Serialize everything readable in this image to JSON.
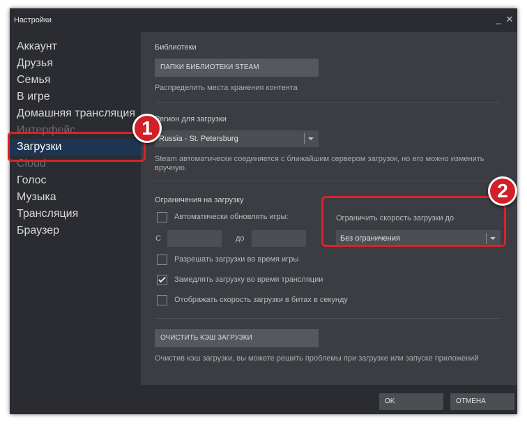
{
  "window": {
    "title": "Настройки"
  },
  "controls": {
    "minimize_icon": "minimize-icon",
    "close_icon": "close-icon",
    "minimize": "_",
    "close": "✕"
  },
  "sidebar": {
    "items": [
      {
        "label": "Аккаунт"
      },
      {
        "label": "Друзья"
      },
      {
        "label": "Семья"
      },
      {
        "label": "В игре"
      },
      {
        "label": "Домашняя трансляция"
      },
      {
        "label": "Интерфейс"
      },
      {
        "label": "Загрузки",
        "active": true
      },
      {
        "label": "Cloud"
      },
      {
        "label": "Голос"
      },
      {
        "label": "Музыка"
      },
      {
        "label": "Трансляция"
      },
      {
        "label": "Браузер"
      }
    ]
  },
  "libraries": {
    "heading": "Библиотеки",
    "button_label": "ПАПКИ БИБЛИОТЕКИ STEAM",
    "description": "Распределить места хранения контента"
  },
  "region": {
    "heading": "Регион для загрузки",
    "selected": "Russia - St. Petersburg",
    "description": "Steam автоматически соединяется с ближайшим сервером загрузок, но его можно изменить вручную."
  },
  "restrictions": {
    "heading": "Ограничения на загрузку",
    "auto_update": {
      "label": "Автоматически обновлять игры:",
      "checked": false
    },
    "from_label": "С",
    "to_label": "до",
    "from_value": "",
    "to_value": "",
    "speed_limit_label": "Ограничить скорость загрузки до",
    "speed_limit_selected": "Без ограничения",
    "options": [
      {
        "label": "Разрешать загрузки во время игры",
        "checked": false
      },
      {
        "label": "Замедлять загрузку во время трансляции",
        "checked": true
      },
      {
        "label": "Отображать скорость загрузки в битах в секунду",
        "checked": false
      }
    ]
  },
  "cache": {
    "button_label": "ОЧИСТИТЬ КЭШ ЗАГРУЗКИ",
    "description": "Очистив кэш загрузки, вы можете решить проблемы при загрузке или запуске приложений"
  },
  "footer": {
    "ok_label": "OK",
    "cancel_label": "ОТМЕНА"
  },
  "annotations": {
    "badge_1": "1",
    "badge_2": "2",
    "color": "#d8232a"
  },
  "colors": {
    "window_bg": "#2a2c31",
    "content_bg": "#3b3d42",
    "active_item_bg": "#1e3552",
    "button_bg": "#55585e"
  }
}
